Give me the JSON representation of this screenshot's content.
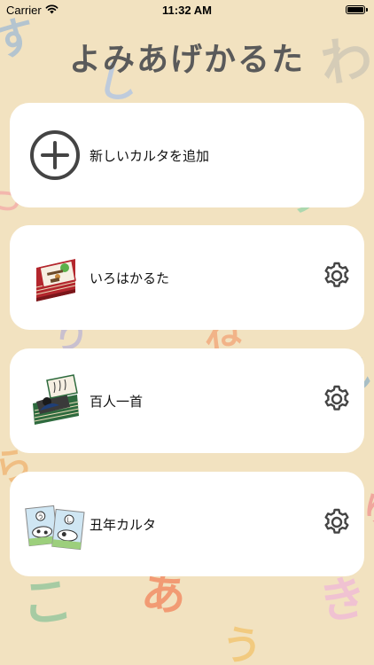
{
  "status_bar": {
    "carrier": "Carrier",
    "time": "11:32 AM",
    "wifi_icon": "wifi-icon",
    "battery_icon": "battery-full-icon"
  },
  "app": {
    "title": "よみあげかるた"
  },
  "add_card": {
    "label": "新しいカルタを追加",
    "icon": "plus-circle-icon"
  },
  "decks": [
    {
      "label": "いろはかるた",
      "icon": "iroha-karuta-thumbnail",
      "settings_icon": "gear-icon"
    },
    {
      "label": "百人一首",
      "icon": "hyakunin-isshu-thumbnail",
      "settings_icon": "gear-icon"
    },
    {
      "label": "丑年カルタ",
      "icon": "ushidoshi-karuta-thumbnail",
      "settings_icon": "gear-icon"
    }
  ],
  "colors": {
    "background": "#f2e2c0",
    "card": "#ffffff",
    "title": "#5a5a5a",
    "icon": "#444444"
  }
}
